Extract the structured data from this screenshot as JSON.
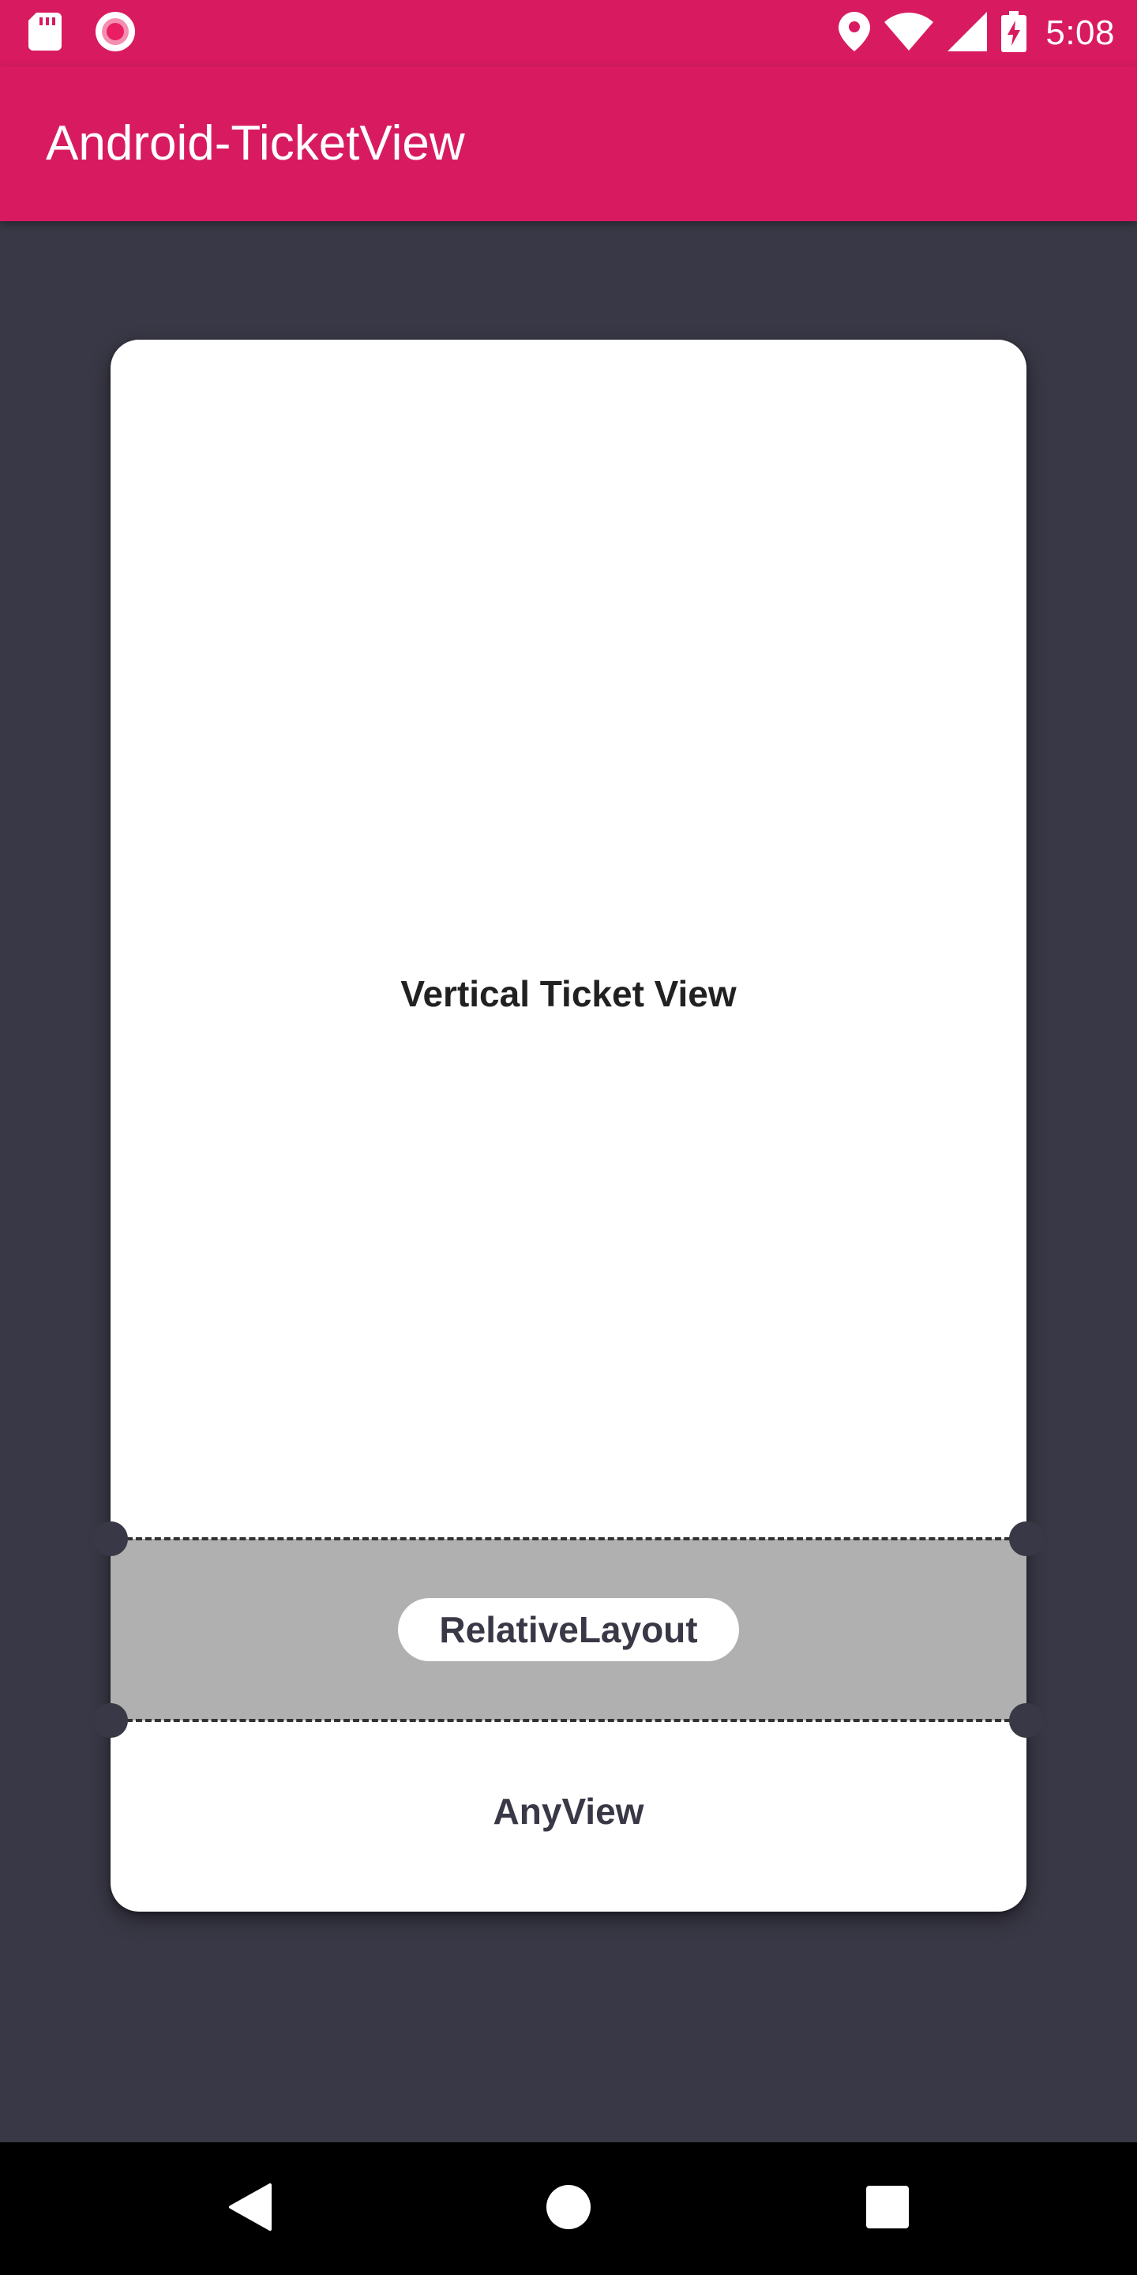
{
  "status_bar": {
    "time": "5:08",
    "icons": [
      "sd-card-icon",
      "record-icon",
      "location-icon",
      "wifi-icon",
      "cell-signal-icon",
      "battery-charging-icon"
    ]
  },
  "app_bar": {
    "title": "Android-TicketView"
  },
  "ticket": {
    "title": "Vertical Ticket View",
    "middle_label": "RelativeLayout",
    "bottom_label": "AnyView"
  },
  "nav_bar": {
    "buttons": [
      "back-icon",
      "home-icon",
      "recents-icon"
    ]
  },
  "colors": {
    "primary": "#d81b60",
    "background": "#393846",
    "ticket": "#ffffff",
    "divider_section": "#b0b0b0",
    "nav_bar": "#000000"
  }
}
